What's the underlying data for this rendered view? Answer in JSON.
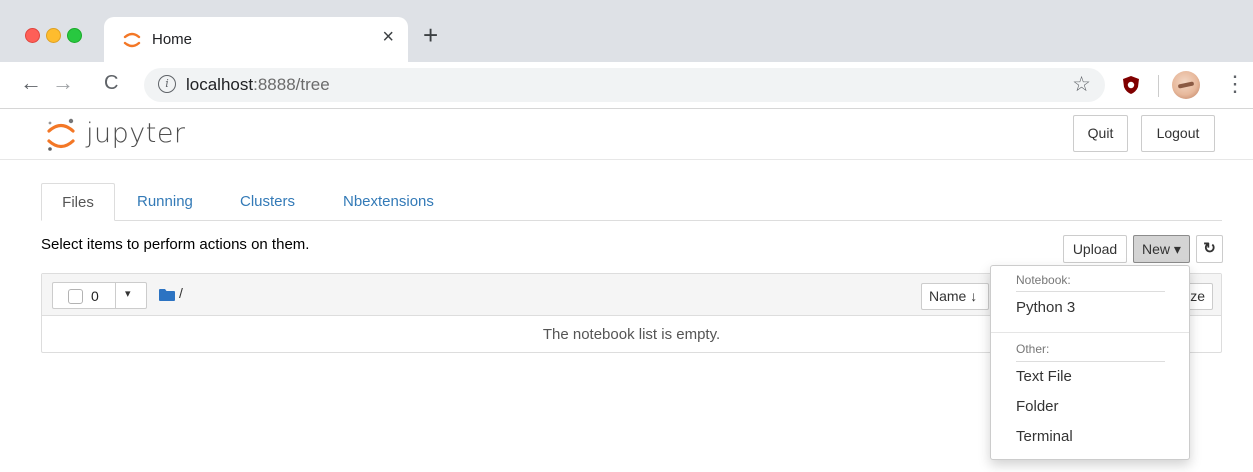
{
  "browser": {
    "tab_title": "Home",
    "tab_close": "×",
    "new_tab": "+",
    "back": "←",
    "forward": "→",
    "reload": "C",
    "url_host": "localhost",
    "url_rest": ":8888/tree",
    "info_glyph": "i",
    "star": "☆",
    "menu": "⋮"
  },
  "header": {
    "brand": "jupyter",
    "quit_label": "Quit",
    "logout_label": "Logout"
  },
  "tabs": [
    {
      "label": "Files"
    },
    {
      "label": "Running"
    },
    {
      "label": "Clusters"
    },
    {
      "label": "Nbextensions"
    }
  ],
  "actions": {
    "message": "Select items to perform actions on them.",
    "upload_label": "Upload",
    "new_label": "New ▾",
    "refresh_glyph": "↻"
  },
  "list": {
    "selected_count": "0",
    "caret": "▾",
    "path": "/",
    "name_sort_label": "Name ↓",
    "size_label": "ze",
    "empty_message": "The notebook list is empty."
  },
  "new_menu": {
    "notebook_header": "Notebook:",
    "notebook_items": [
      "Python 3"
    ],
    "other_header": "Other:",
    "other_items": [
      "Text File",
      "Folder",
      "Terminal"
    ]
  },
  "colors": {
    "jupyter_orange": "#f37726",
    "link_blue": "#337ab7",
    "folder_blue": "#2c73c2",
    "ublock_red": "#800000"
  }
}
